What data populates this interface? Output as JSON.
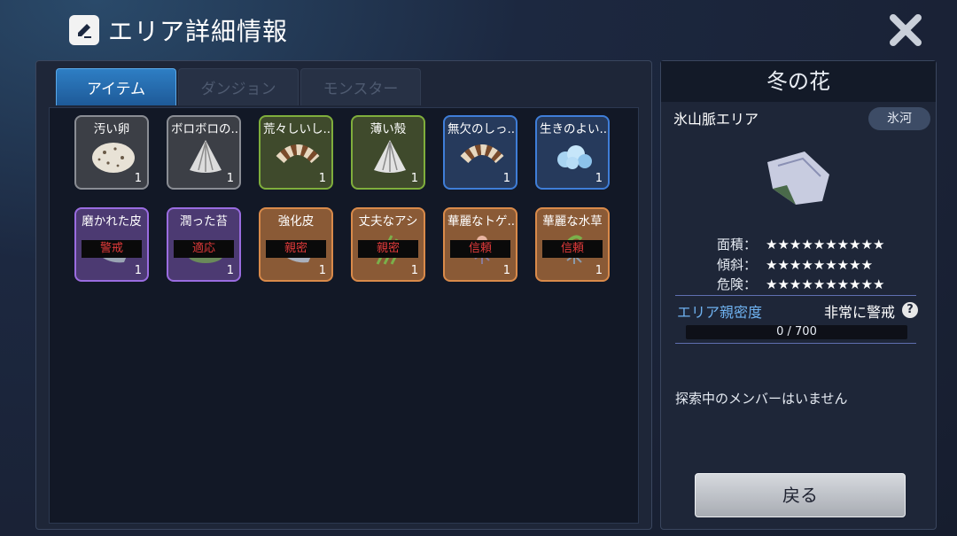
{
  "header": {
    "title": "エリア詳細情報",
    "icon": "edit-icon",
    "close_icon": "close-icon"
  },
  "tabs": [
    {
      "label": "アイテム",
      "active": true
    },
    {
      "label": "ダンジョン",
      "active": false
    },
    {
      "label": "モンスター",
      "active": false
    }
  ],
  "items": [
    {
      "name": "汚い卵",
      "count": "1",
      "rarity": "gray",
      "icon": "egg-icon",
      "badge": ""
    },
    {
      "name": "ボロボロの..",
      "count": "1",
      "rarity": "gray",
      "icon": "shell-icon",
      "badge": ""
    },
    {
      "name": "荒々しいし..",
      "count": "1",
      "rarity": "green",
      "icon": "striped-tail-icon",
      "badge": ""
    },
    {
      "name": "薄い殻",
      "count": "1",
      "rarity": "green",
      "icon": "shell-icon",
      "badge": ""
    },
    {
      "name": "無欠のしっ..",
      "count": "1",
      "rarity": "blue",
      "icon": "striped-tail-icon",
      "badge": ""
    },
    {
      "name": "生きのよい..",
      "count": "1",
      "rarity": "blue",
      "icon": "ice-cluster-icon",
      "badge": ""
    },
    {
      "name": "磨かれた皮",
      "count": "1",
      "rarity": "purple",
      "icon": "hide-icon",
      "badge": "警戒"
    },
    {
      "name": "潤った苔",
      "count": "1",
      "rarity": "purple",
      "icon": "moss-icon",
      "badge": "適応"
    },
    {
      "name": "強化皮",
      "count": "1",
      "rarity": "orange",
      "icon": "hide-icon",
      "badge": "親密"
    },
    {
      "name": "丈夫なアシ",
      "count": "1",
      "rarity": "orange",
      "icon": "reed-icon",
      "badge": "親密"
    },
    {
      "name": "華麗なトゲ..",
      "count": "1",
      "rarity": "orange",
      "icon": "thorn-flower-icon",
      "badge": "信頼"
    },
    {
      "name": "華麗な水草",
      "count": "1",
      "rarity": "orange",
      "icon": "water-plant-icon",
      "badge": "信頼"
    }
  ],
  "area": {
    "name": "冬の花",
    "region": "氷山脈エリア",
    "terrain": "氷河",
    "stats": [
      {
        "label": "面積：",
        "stars": "★★★★★★★★★★",
        "value": 10
      },
      {
        "label": "傾斜：",
        "stars": "★★★★★★★★★",
        "value": 9
      },
      {
        "label": "危険：",
        "stars": "★★★★★★★★★★",
        "value": 10
      }
    ],
    "affinity_label": "エリア親密度",
    "affinity_status": "非常に警戒",
    "affinity_help": "?",
    "affinity_progress": "0 / 700",
    "affinity_fraction": 0,
    "explore_text": "探索中のメンバーはいません",
    "back_label": "戻る"
  }
}
